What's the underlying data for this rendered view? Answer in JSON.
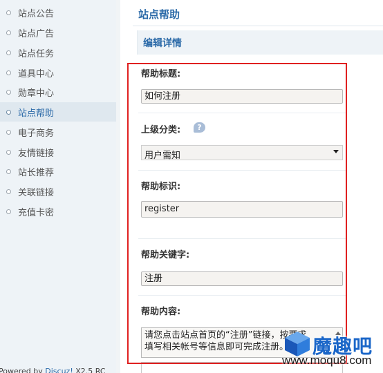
{
  "sidebar": {
    "items": [
      {
        "label": "站点公告"
      },
      {
        "label": "站点广告"
      },
      {
        "label": "站点任务"
      },
      {
        "label": "道具中心"
      },
      {
        "label": "勋章中心"
      },
      {
        "label": "站点帮助",
        "active": true
      },
      {
        "label": "电子商务"
      },
      {
        "label": "友情链接"
      },
      {
        "label": "站长推荐"
      },
      {
        "label": "关联链接"
      },
      {
        "label": "充值卡密"
      }
    ],
    "footer_prefix": "Powered by ",
    "footer_link": "Discuz!",
    "footer_suffix": " X2.5 RC"
  },
  "main": {
    "page_title": "站点帮助",
    "section_title": "编辑详情"
  },
  "form": {
    "help_title_label": "帮助标题:",
    "help_title_value": "如何注册",
    "parent_category_label": "上级分类:",
    "parent_category_value": "用户需知",
    "help_identifier_label": "帮助标识:",
    "help_identifier_value": "register",
    "help_keyword_label": "帮助关键字:",
    "help_keyword_value": "注册",
    "help_content_label": "帮助内容:",
    "help_content_line1": "请您点击站点首页的“注册”链接，按要求",
    "help_content_line2": "填写相关帐号等信息即可完成注册。"
  },
  "watermark": {
    "brand": "魔趣吧",
    "url": "www.moqu8.com"
  },
  "colors": {
    "accent": "#2b6aa8",
    "highlight_border": "#e02020",
    "sidebar_bg": "#eef3f7"
  }
}
